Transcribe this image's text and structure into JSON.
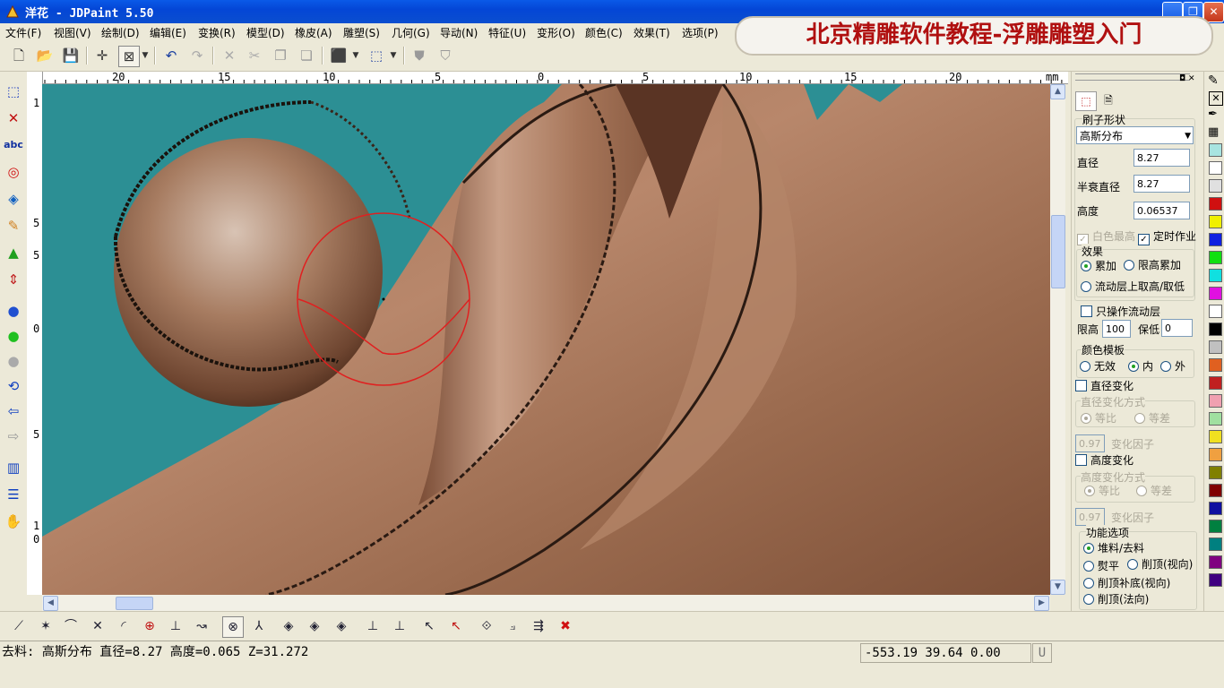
{
  "window": {
    "title": "洋花 - JDPaint 5.50"
  },
  "banner": "北京精雕软件教程-浮雕雕塑入门",
  "menu": [
    "文件(F)",
    "视图(V)",
    "绘制(D)",
    "编辑(E)",
    "变换(R)",
    "模型(D)",
    "橡皮(A)",
    "雕塑(S)",
    "几何(G)",
    "导动(N)",
    "特征(U)",
    "变形(O)",
    "颜色(C)",
    "效果(T)",
    "选项(P)"
  ],
  "ruler": {
    "unit": "mm",
    "h_labels": [
      "20",
      "15",
      "10",
      "5",
      "0",
      "5",
      "10",
      "15",
      "20"
    ],
    "v_labels": [
      "1",
      "5",
      "5",
      "0",
      "5",
      "1",
      "0"
    ]
  },
  "panel": {
    "brush_shape_label": "刷子形状",
    "brush_shape_value": "高斯分布",
    "diameter_label": "直径",
    "diameter_value": "8.27",
    "half_decay_label": "半衰直径",
    "half_decay_value": "8.27",
    "height_label": "高度",
    "height_value": "0.06537",
    "white_highest": "白色最高",
    "timed_work": "定时作业",
    "effect_group": "效果",
    "effect_accumulate": "累加",
    "effect_limit_accumulate": "限高累加",
    "effect_flow": "流动层上取高/取低",
    "only_flow_layer": "只操作流动层",
    "limit_high_label": "限高",
    "limit_high_value": "100",
    "keep_low_label": "保低",
    "keep_low_value": "0",
    "color_template_group": "颜色模板",
    "ct_none": "无效",
    "ct_inner": "内",
    "ct_outer": "外",
    "diameter_change": "直径变化",
    "diameter_change_mode": "直径变化方式",
    "ratio": "等比",
    "diff": "等差",
    "factor_value": "0.97",
    "factor_label": "变化因子",
    "height_change": "高度变化",
    "height_change_mode": "高度变化方式",
    "ratio2": "等比",
    "diff2": "等差",
    "factor_value2": "0.97",
    "factor_label2": "变化因子",
    "function_group": "功能选项",
    "fn_pile": "堆料/去料",
    "fn_flatten": "熨平",
    "fn_cut_top_view": "削顶(视向)",
    "fn_cut_top_fill": "削顶补底(视向)",
    "fn_cut_top_normal": "削顶(法向)"
  },
  "palette": [
    "#a8e4e0",
    "#ffffff",
    "#e0e0e0",
    "#d01010",
    "#f0f000",
    "#1020e0",
    "#10e010",
    "#10e0e0",
    "#e010e0",
    "#ffffff",
    "#000000",
    "#c0c0c0",
    "#e06020",
    "#c02020",
    "#f0a0b0",
    "#a0e0a0",
    "#f0e020",
    "#f0a040",
    "#808000",
    "#800000",
    "#1010a0",
    "#008040",
    "#008080",
    "#800080",
    "#400080"
  ],
  "status": {
    "left": "去料: 高斯分布  直径=8.27  高度=0.065  Z=31.272",
    "coords": "-553.19 39.64 0.00",
    "u": "U"
  },
  "icons": {
    "toolbar": [
      "new-file-icon",
      "open-folder-icon",
      "save-icon",
      "crosshair-icon",
      "view-box-icon",
      "dropdown-icon",
      "undo-icon",
      "redo-icon",
      "delete-icon",
      "cut-icon",
      "copy-icon",
      "paste-icon",
      "cube-icon",
      "dropdown-icon",
      "cube-wire-icon",
      "dropdown-icon",
      "relief-icon",
      "relief-shade-icon"
    ]
  }
}
